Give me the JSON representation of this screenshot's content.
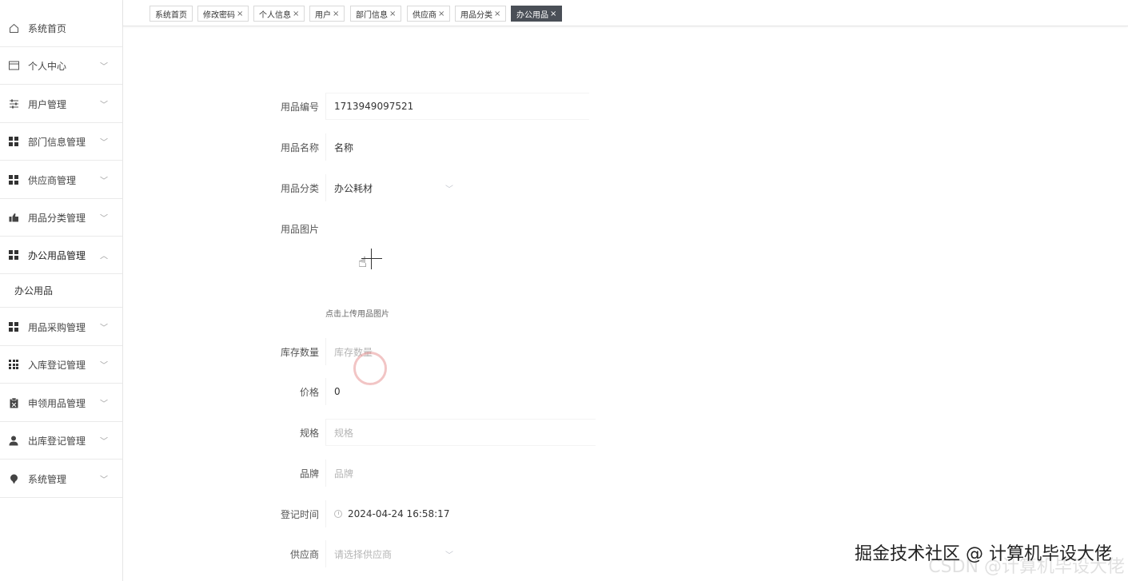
{
  "sidebar": {
    "items": [
      {
        "label": "系统首页",
        "icon": "home-icon"
      },
      {
        "label": "个人中心",
        "icon": "calendar-icon"
      },
      {
        "label": "用户管理",
        "icon": "sliders-icon"
      },
      {
        "label": "部门信息管理",
        "icon": "grid-icon"
      },
      {
        "label": "供应商管理",
        "icon": "grid-icon"
      },
      {
        "label": "用品分类管理",
        "icon": "thumb-icon"
      },
      {
        "label": "办公用品管理",
        "icon": "grid-icon"
      },
      {
        "label": "办公用品",
        "icon": ""
      },
      {
        "label": "用品采购管理",
        "icon": "grid-icon"
      },
      {
        "label": "入库登记管理",
        "icon": "apps-icon"
      },
      {
        "label": "申领用品管理",
        "icon": "clipboard-icon"
      },
      {
        "label": "出库登记管理",
        "icon": "user-icon"
      },
      {
        "label": "系统管理",
        "icon": "pin-icon"
      }
    ]
  },
  "tabs": [
    {
      "label": "系统首页",
      "closable": false
    },
    {
      "label": "修改密码",
      "closable": true
    },
    {
      "label": "个人信息",
      "closable": true
    },
    {
      "label": "用户",
      "closable": true
    },
    {
      "label": "部门信息",
      "closable": true
    },
    {
      "label": "供应商",
      "closable": true
    },
    {
      "label": "用品分类",
      "closable": true
    },
    {
      "label": "办公用品",
      "closable": true,
      "active": true
    }
  ],
  "close_glyph": "×",
  "form": {
    "code": {
      "label": "用品编号",
      "value": "1713949097521"
    },
    "name": {
      "label": "用品名称",
      "value": "名称"
    },
    "category": {
      "label": "用品分类",
      "value": "办公耗材"
    },
    "image": {
      "label": "用品图片",
      "hint": "点击上传用品图片"
    },
    "stock": {
      "label": "库存数量",
      "placeholder": "库存数量"
    },
    "price": {
      "label": "价格",
      "value": "0"
    },
    "spec": {
      "label": "规格",
      "placeholder": "规格"
    },
    "brand": {
      "label": "品牌",
      "placeholder": "品牌"
    },
    "reg_time": {
      "label": "登记时间",
      "value": "2024-04-24 16:58:17"
    },
    "supplier": {
      "label": "供应商",
      "placeholder": "请选择供应商"
    }
  },
  "watermark": "掘金技术社区 @ 计算机毕设大佬",
  "watermark_shadow": "CSDN @计算机毕设大佬"
}
